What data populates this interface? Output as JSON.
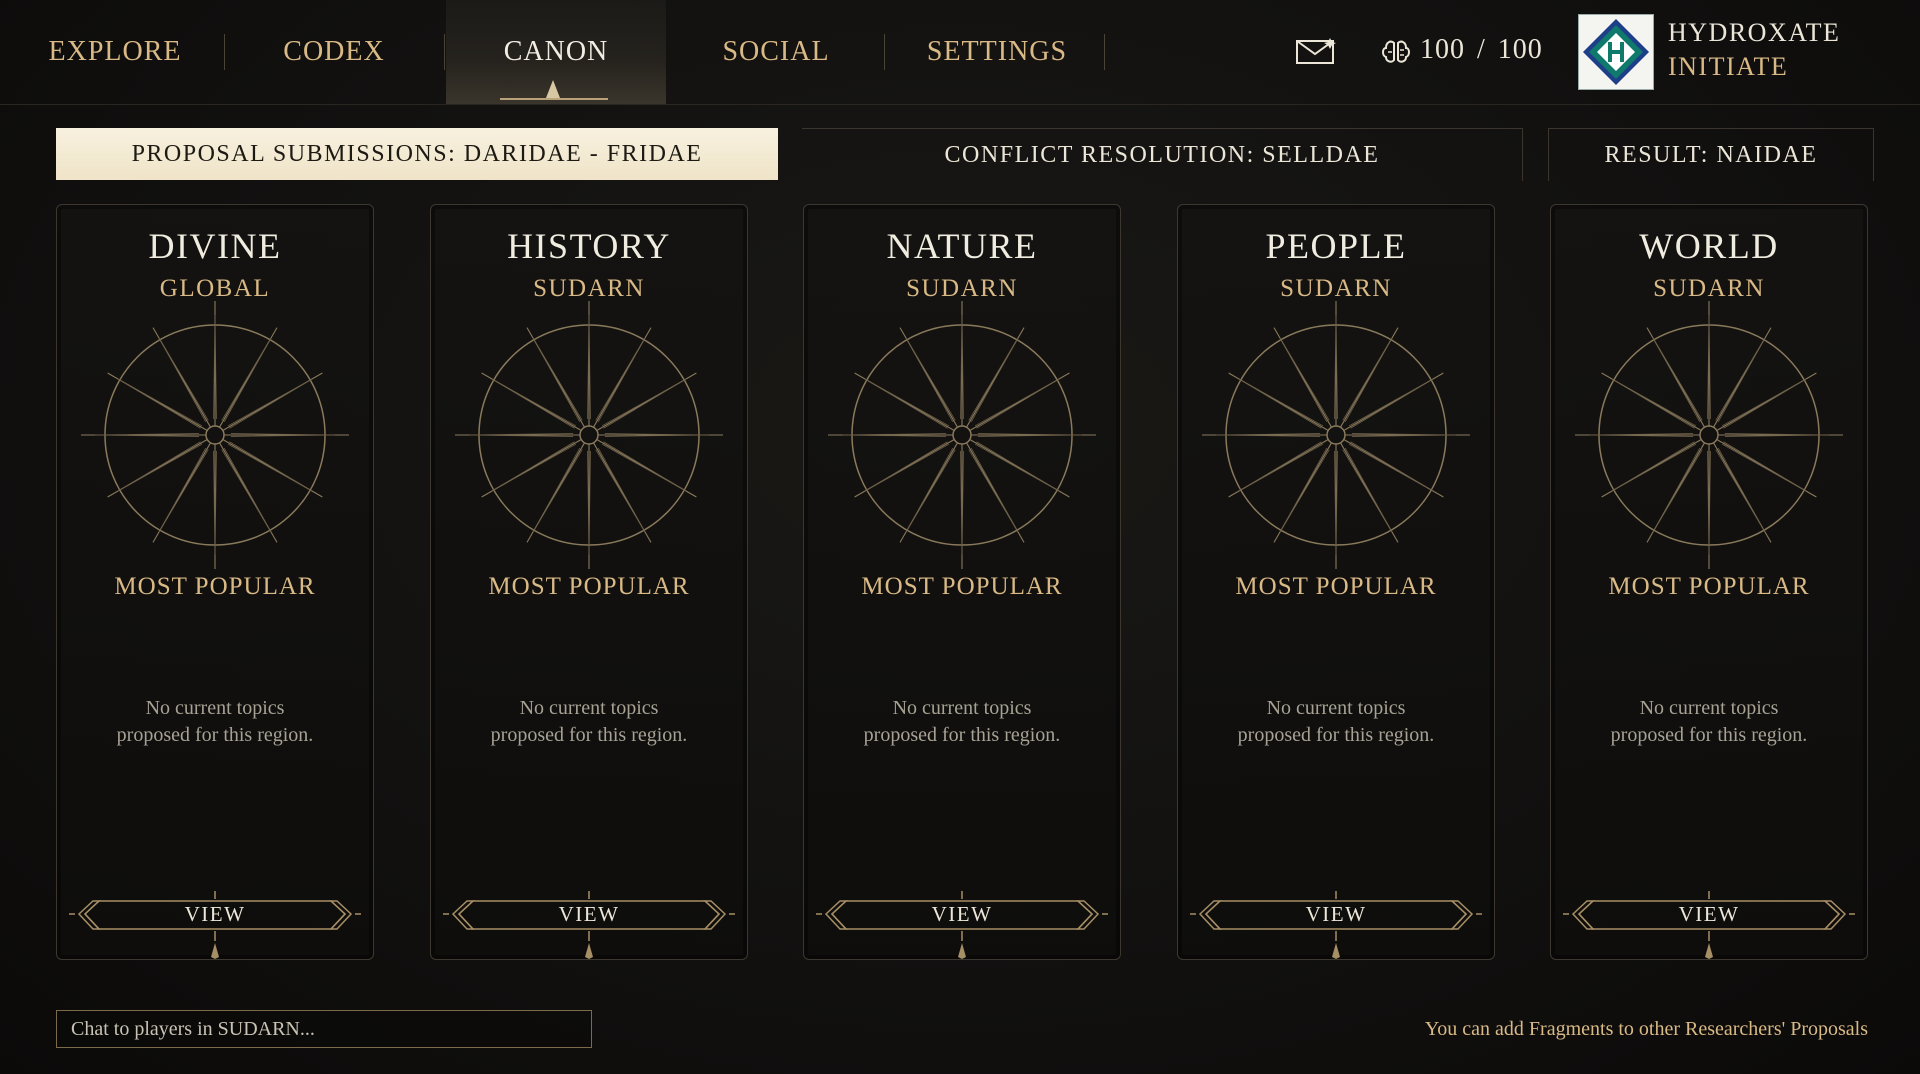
{
  "nav": {
    "tabs": [
      {
        "label": "EXPLORE"
      },
      {
        "label": "CODEX"
      },
      {
        "label": "CANON",
        "active": true
      },
      {
        "label": "SOCIAL"
      },
      {
        "label": "SETTINGS"
      }
    ]
  },
  "status": {
    "mail_icon": "envelope-icon",
    "energy_icon": "brain-icon",
    "energy_current": "100",
    "energy_sep": "/",
    "energy_max": "100"
  },
  "user": {
    "name": "HYDROXATE",
    "rank": "INITIATE",
    "emblem_icon": "diamond-h-emblem-icon",
    "emblem_colors": [
      "#0f7a6b",
      "#1d3f8a",
      "#ffffff"
    ]
  },
  "phases": [
    {
      "label": "PROPOSAL SUBMISSIONS: DARIDAE - FRIDAE",
      "active": true
    },
    {
      "label": "CONFLICT RESOLUTION: SELLDAE",
      "active": false
    },
    {
      "label": "RESULT: NAIDAE",
      "active": false
    }
  ],
  "cards": [
    {
      "title": "DIVINE",
      "region": "GLOBAL",
      "popular": "MOST POPULAR",
      "empty_line1": "No current topics",
      "empty_line2": "proposed for this region.",
      "view": "VIEW"
    },
    {
      "title": "HISTORY",
      "region": "SUDARN",
      "popular": "MOST POPULAR",
      "empty_line1": "No current topics",
      "empty_line2": "proposed for this region.",
      "view": "VIEW"
    },
    {
      "title": "NATURE",
      "region": "SUDARN",
      "popular": "MOST POPULAR",
      "empty_line1": "No current topics",
      "empty_line2": "proposed for this region.",
      "view": "VIEW"
    },
    {
      "title": "PEOPLE",
      "region": "SUDARN",
      "popular": "MOST POPULAR",
      "empty_line1": "No current topics",
      "empty_line2": "proposed for this region.",
      "view": "VIEW"
    },
    {
      "title": "WORLD",
      "region": "SUDARN",
      "popular": "MOST POPULAR",
      "empty_line1": "No current topics",
      "empty_line2": "proposed for this region.",
      "view": "VIEW"
    }
  ],
  "chat": {
    "placeholder": "Chat to players in SUDARN..."
  },
  "hint": "You can add Fragments to other Researchers' Proposals",
  "colors": {
    "accent_gold": "#d9b985",
    "text_light": "#ece6d8",
    "active_phase_bg": "#f3e9d0",
    "background": "#121110"
  }
}
